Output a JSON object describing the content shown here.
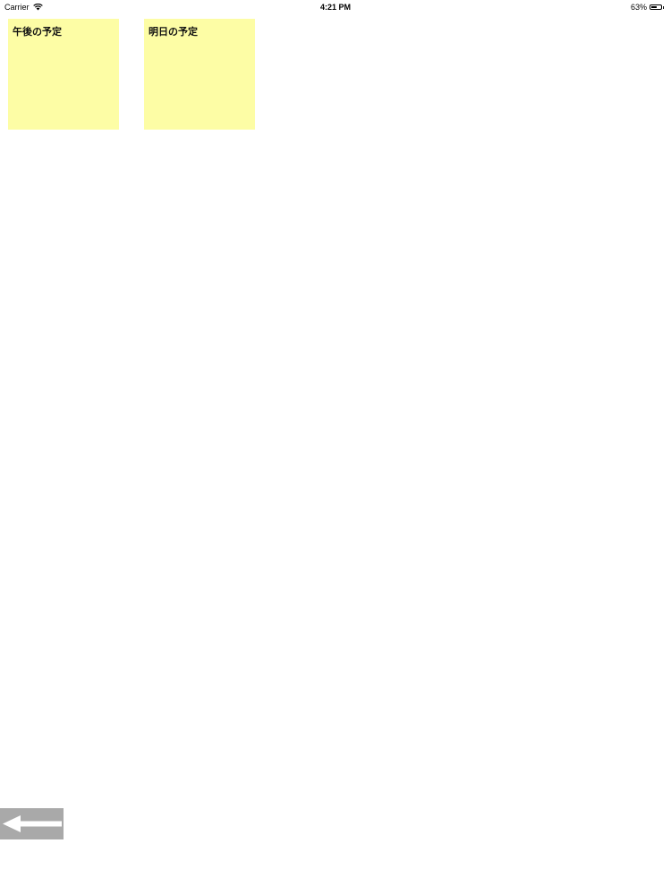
{
  "status_bar": {
    "carrier": "Carrier",
    "time": "4:21 PM",
    "battery_percent": "63%",
    "battery_level": 0.63
  },
  "notes": [
    {
      "title": "午後の予定",
      "color": "#fdfda5"
    },
    {
      "title": "明日の予定",
      "color": "#fdfda5"
    }
  ],
  "back_button": {
    "icon": "left-arrow-icon",
    "background": "#a9a9a9"
  }
}
